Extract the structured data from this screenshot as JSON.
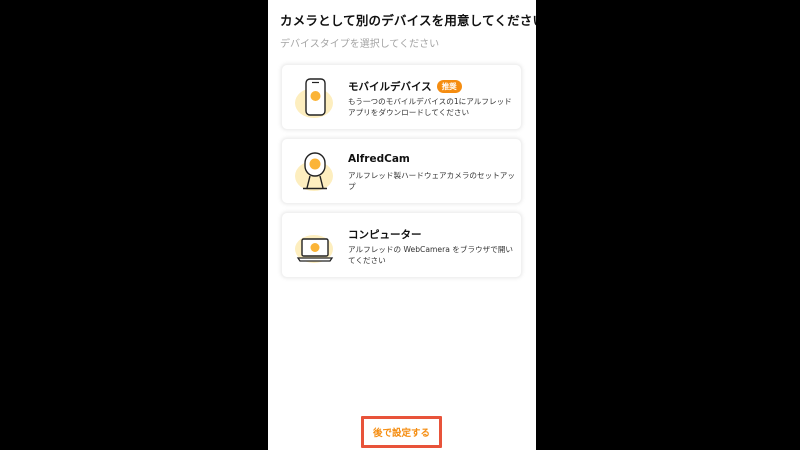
{
  "header": {
    "title": "カメラとして別のデバイスを用意してください",
    "subtitle": "デバイスタイプを選択してください"
  },
  "options": [
    {
      "icon": "smartphone-icon",
      "name": "モバイルデバイス",
      "badge": "推奨",
      "description": "もう一つのモバイルデバイスの1にアルフレッドアプリをダウンロードしてください"
    },
    {
      "icon": "alfredcam-icon",
      "name": "AlfredCam",
      "description": "アルフレッド製ハードウェアカメラのセットアップ"
    },
    {
      "icon": "laptop-icon",
      "name": "コンピューター",
      "description": "アルフレッドの WebCamera をブラウザで開いてください"
    }
  ],
  "footer": {
    "later_label": "後で設定する"
  },
  "colors": {
    "accent": "#f58d11",
    "highlight_border": "#e8533a",
    "icon_glow": "#fdeebf"
  }
}
